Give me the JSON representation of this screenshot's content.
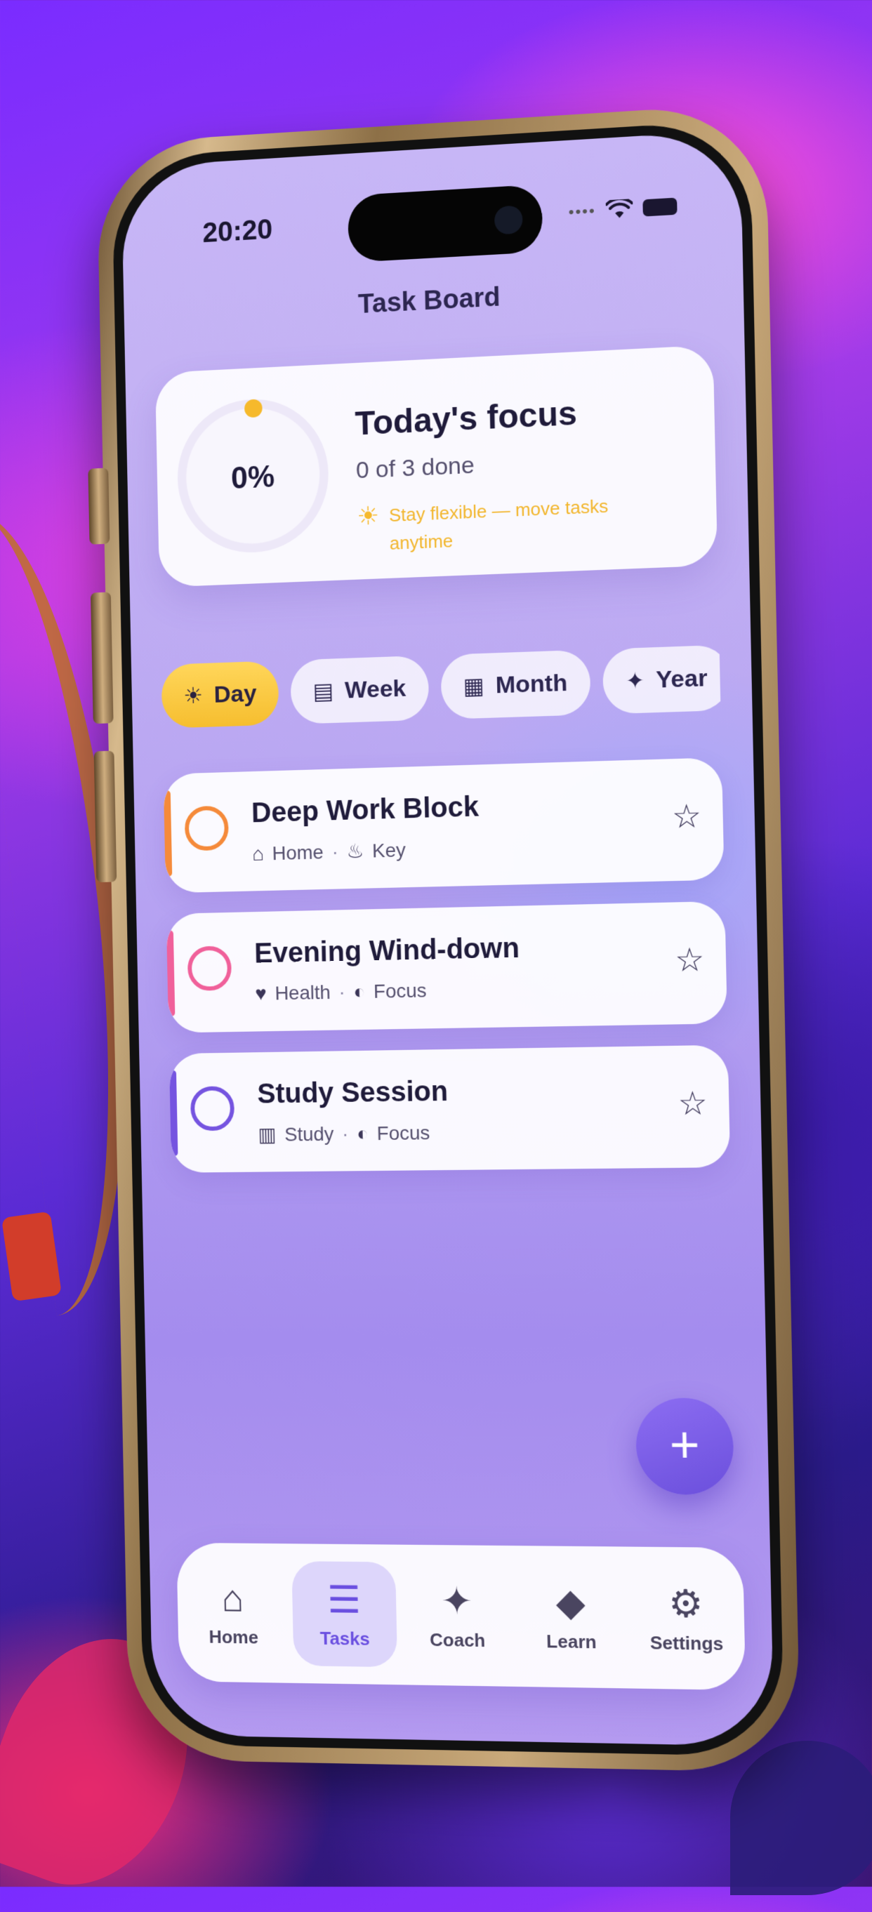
{
  "status_bar": {
    "time": "20:20"
  },
  "nav": {
    "title": "Task Board"
  },
  "focus_card": {
    "progress_label": "0%",
    "progress_fraction": 0,
    "title": "Today's focus",
    "subtitle": "0 of 3 done",
    "tip": "Stay flexible — move tasks anytime",
    "tip_icon": "sun-icon"
  },
  "filters": [
    {
      "label": "Day",
      "icon": "sun-icon",
      "active": true
    },
    {
      "label": "Week",
      "icon": "calendar-icon",
      "active": false
    },
    {
      "label": "Month",
      "icon": "calendar-grid-icon",
      "active": false
    },
    {
      "label": "Year",
      "icon": "sparkle-icon",
      "active": false
    }
  ],
  "tasks": [
    {
      "title": "Deep Work Block",
      "category": "Home",
      "category_icon": "home-icon",
      "tag": "Key",
      "tag_icon": "flame-icon",
      "color": "#f58a3a"
    },
    {
      "title": "Evening Wind-down",
      "category": "Health",
      "category_icon": "heart-icon",
      "tag": "Focus",
      "tag_icon": "half-circle-icon",
      "color": "#f0609a"
    },
    {
      "title": "Study Session",
      "category": "Study",
      "category_icon": "book-icon",
      "tag": "Focus",
      "tag_icon": "half-circle-icon",
      "color": "#7554e0"
    }
  ],
  "fab": {
    "label": "+"
  },
  "tabbar": [
    {
      "label": "Home",
      "icon": "home-icon",
      "active": false
    },
    {
      "label": "Tasks",
      "icon": "checklist-icon",
      "active": true
    },
    {
      "label": "Coach",
      "icon": "sparkle-icon",
      "active": false
    },
    {
      "label": "Learn",
      "icon": "graduation-cap-icon",
      "active": false
    },
    {
      "label": "Settings",
      "icon": "gear-icon",
      "active": false
    }
  ],
  "colors": {
    "accent": "#6a4fe0",
    "highlight": "#f6be2f"
  }
}
